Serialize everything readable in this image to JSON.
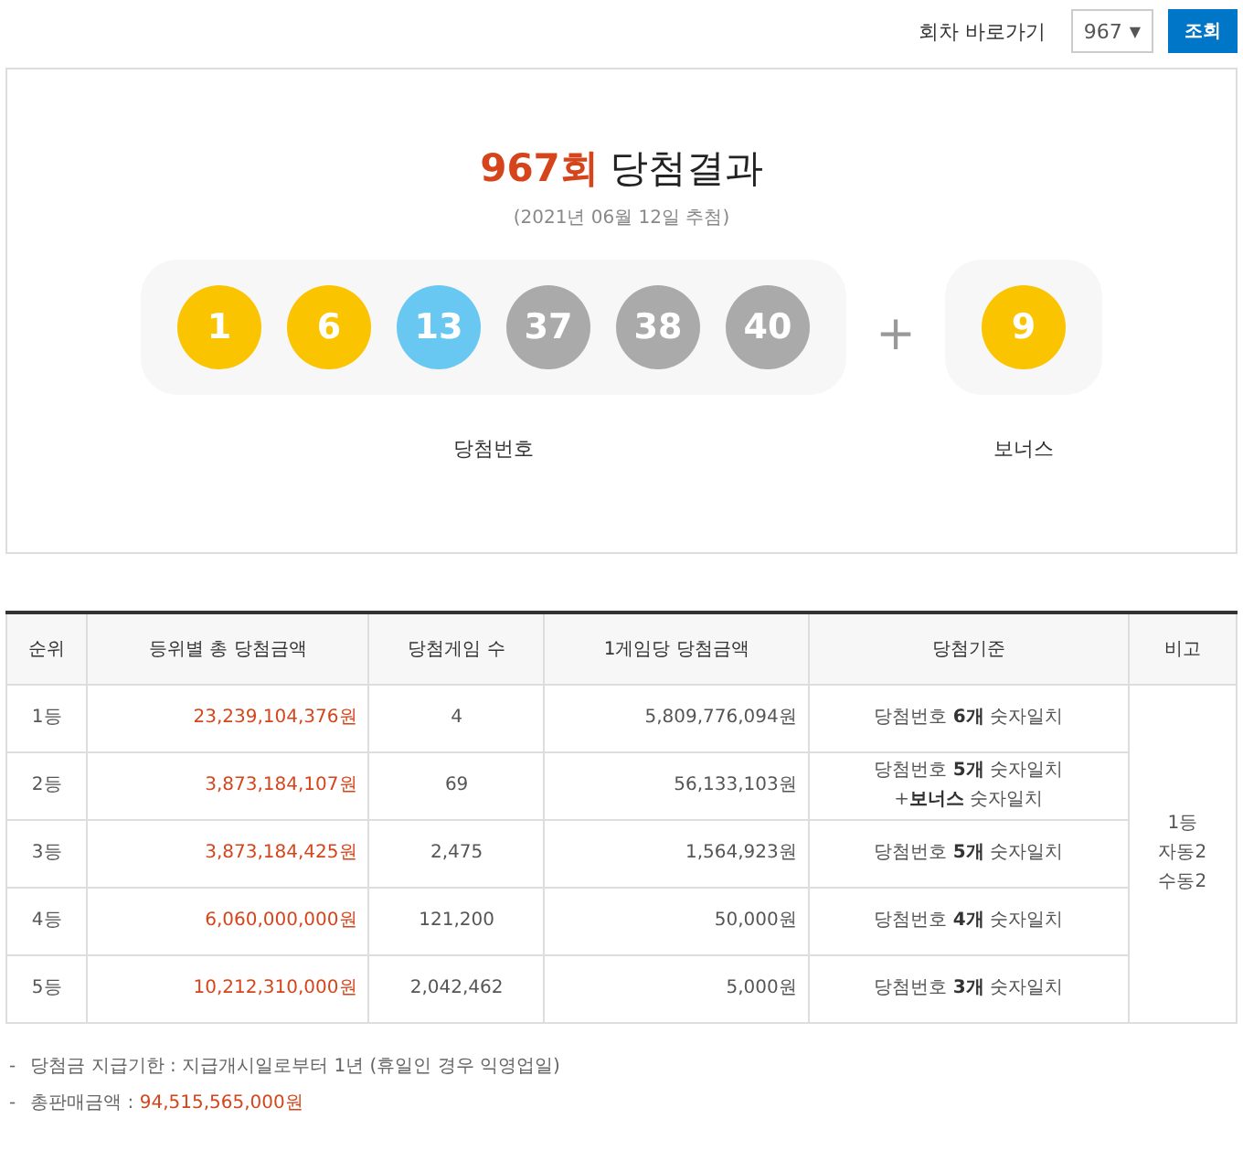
{
  "round_nav": {
    "label": "회차 바로가기",
    "value": "967",
    "caret": "▼",
    "button": "조회"
  },
  "result": {
    "round": "967회",
    "title": "당첨결과",
    "date": "(2021년 06월 12일 추첨)",
    "numbers": [
      {
        "value": "1",
        "color": "#fbc400"
      },
      {
        "value": "6",
        "color": "#fbc400"
      },
      {
        "value": "13",
        "color": "#69c8f2"
      },
      {
        "value": "37",
        "color": "#aaaaaa"
      },
      {
        "value": "38",
        "color": "#aaaaaa"
      },
      {
        "value": "40",
        "color": "#aaaaaa"
      }
    ],
    "plus": "+",
    "bonus": {
      "value": "9",
      "color": "#fbc400"
    },
    "numbers_label": "당첨번호",
    "bonus_label": "보너스"
  },
  "table": {
    "columns": [
      "순위",
      "등위별 총 당첨금액",
      "당첨게임 수",
      "1게임당 당첨금액",
      "당첨기준",
      "비고"
    ],
    "rows": [
      {
        "rank": "1등",
        "total": "23,239,104,376원",
        "count": "4",
        "per_game": "5,809,776,094원",
        "criteria": [
          "당첨번호 **6개** 숫자일치"
        ]
      },
      {
        "rank": "2등",
        "total": "3,873,184,107원",
        "count": "69",
        "per_game": "56,133,103원",
        "criteria": [
          "당첨번호 **5개** 숫자일치",
          "+**보너스** 숫자일치"
        ]
      },
      {
        "rank": "3등",
        "total": "3,873,184,425원",
        "count": "2,475",
        "per_game": "1,564,923원",
        "criteria": [
          "당첨번호 **5개** 숫자일치"
        ]
      },
      {
        "rank": "4등",
        "total": "6,060,000,000원",
        "count": "121,200",
        "per_game": "50,000원",
        "criteria": [
          "당첨번호 **4개** 숫자일치"
        ]
      },
      {
        "rank": "5등",
        "total": "10,212,310,000원",
        "count": "2,042,462",
        "per_game": "5,000원",
        "criteria": [
          "당첨번호 **3개** 숫자일치"
        ]
      }
    ],
    "remark": [
      "1등",
      "자동2",
      "수동2"
    ]
  },
  "notes": [
    {
      "bullet": "-",
      "label": "당첨금 지급기한 : ",
      "value": "지급개시일로부터 1년 (휴일인 경우 익영업일)",
      "highlight": false
    },
    {
      "bullet": "-",
      "label": "총판매금액 : ",
      "value": "94,515,565,000원",
      "highlight": true
    }
  ]
}
